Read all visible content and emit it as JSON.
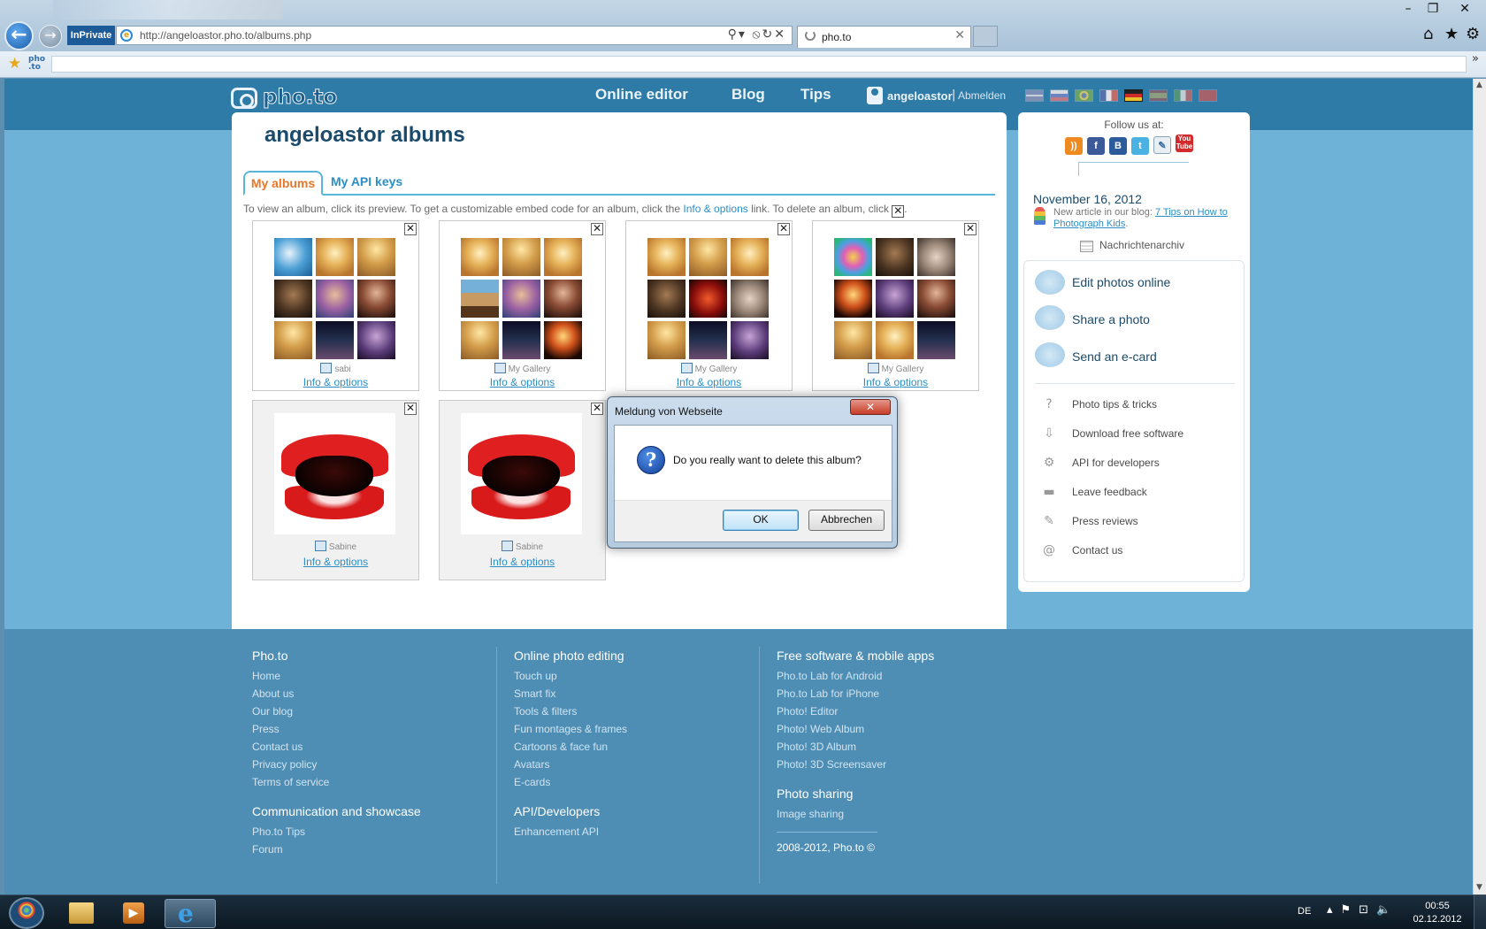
{
  "browser": {
    "inprivate_label": "InPrivate",
    "url": "http://angeloastor.pho.to/albums.php",
    "tab_title": "pho.to",
    "window_controls": [
      "–",
      "❐",
      "✕"
    ],
    "address_icons": "⚲▾ ⦸↻✕",
    "tab_close": "✕",
    "fav_pho_label": "pho\n.to",
    "fav_more": "»"
  },
  "site": {
    "logo_text": "pho.to",
    "nav": {
      "editor": "Online editor",
      "blog": "Blog",
      "tips": "Tips"
    },
    "user": {
      "name": "angeloastor",
      "separator": "|",
      "logout": "Abmelden"
    },
    "flags": [
      "en",
      "ru",
      "pt-br",
      "fr",
      "de",
      "es",
      "it",
      "tr"
    ]
  },
  "albums_page": {
    "title": "angeloastor albums",
    "tabs": {
      "my_albums": "My albums",
      "api_keys": "My API keys"
    },
    "instructions": {
      "part1": "To view an album, click its preview. To get a customizable embed code for an album, click the ",
      "link": "Info & options",
      "part2": " link. To delete an album, click ",
      "x": "✕",
      "end": "."
    },
    "delete_icon": "✕",
    "albums": [
      {
        "owner": "sabi",
        "info": "Info & options"
      },
      {
        "owner": "My Gallery",
        "info": "Info & options"
      },
      {
        "owner": "My Gallery",
        "info": "Info & options"
      },
      {
        "owner": "My Gallery",
        "info": "Info & options"
      },
      {
        "owner": "Sabine",
        "info": "Info & options"
      },
      {
        "owner": "Sabine",
        "info": "Info & options"
      }
    ]
  },
  "sidebar": {
    "follow_label": "Follow us at:",
    "social": {
      "rss": "))",
      "facebook": "f",
      "blogger": "B",
      "twitter": "t",
      "vk": "✎",
      "youtube": "You\nTube"
    },
    "blog_date": "November 16, 2012",
    "blog_prefix": "New article in our blog: ",
    "blog_link": "7 Tips on How to Photograph Kids",
    "blog_suffix": ".",
    "archive": "Nachrichtenarchiv",
    "main_links": {
      "edit": "Edit photos online",
      "share": "Share a photo",
      "ecard": "Send an e-card"
    },
    "sub_links": {
      "tips": "Photo tips & tricks",
      "download": "Download free software",
      "api": "API for developers",
      "feedback": "Leave feedback",
      "press": "Press reviews",
      "contact": "Contact us"
    },
    "sub_icons": {
      "tips": "?",
      "download": "⇩",
      "api": "⚙",
      "feedback": "▬",
      "press": "✎",
      "contact": "@"
    }
  },
  "footer": {
    "col1": {
      "heading": "Pho.to",
      "links": [
        "Home",
        "About us",
        "Our blog",
        "Press",
        "Contact us",
        "Privacy policy",
        "Terms of service"
      ],
      "heading2": "Communication and showcase",
      "links2": [
        "Pho.to Tips",
        "Forum"
      ]
    },
    "col2": {
      "heading": "Online photo editing",
      "links": [
        "Touch up",
        "Smart fix",
        "Tools & filters",
        "Fun montages & frames",
        "Cartoons & face fun",
        "Avatars",
        "E-cards"
      ],
      "heading2": "API/Developers",
      "links2": [
        "Enhancement API"
      ]
    },
    "col3": {
      "heading": "Free software & mobile apps",
      "links": [
        "Pho.to Lab for Android",
        "Pho.to Lab for iPhone",
        "Photo! Editor",
        "Photo! Web Album",
        "Photo! 3D Album",
        "Photo! 3D Screensaver"
      ],
      "heading2": "Photo sharing",
      "links2": [
        "Image sharing"
      ],
      "copyright": "2008-2012, Pho.to ©"
    }
  },
  "dialog": {
    "title": "Meldung von Webseite",
    "close": "✕",
    "icon": "?",
    "message": "Do you really want to delete this album?",
    "ok": "OK",
    "cancel": "Abbrechen"
  },
  "taskbar": {
    "media_icon": "▶",
    "ie_icon": "e",
    "lang": "DE",
    "tray_icons": "▴⚑⊡🔈",
    "time": "00:55",
    "date": "02.12.2012"
  }
}
